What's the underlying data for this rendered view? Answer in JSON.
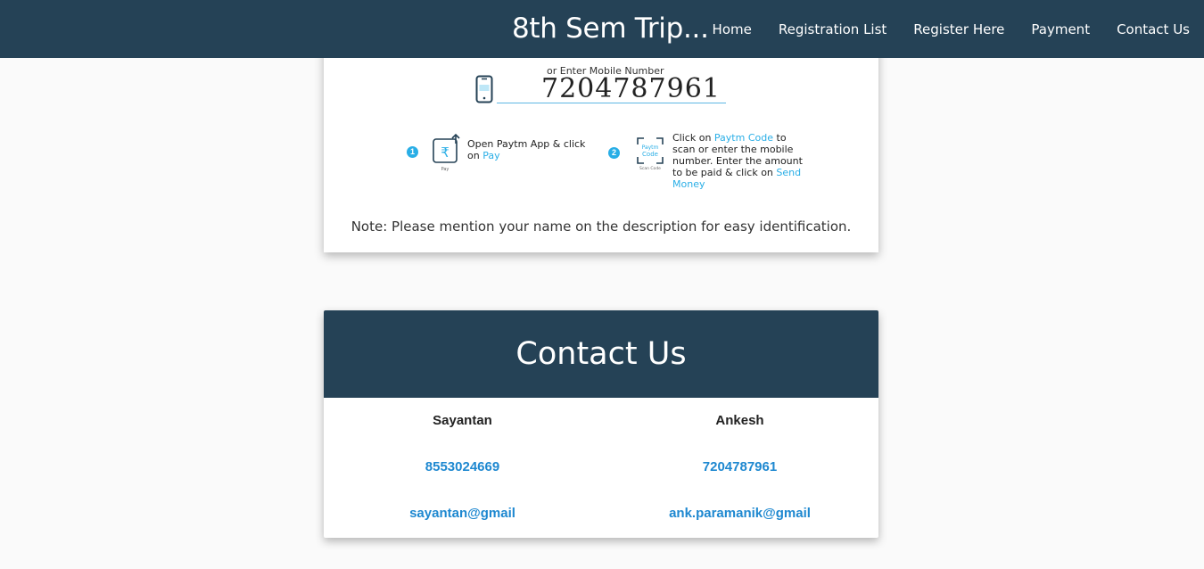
{
  "navbar": {
    "brand": "8th Sem Trip...",
    "links": [
      "Home",
      "Registration List",
      "Register Here",
      "Payment",
      "Contact Us"
    ]
  },
  "payment": {
    "mobile_label": "or Enter Mobile Number",
    "mobile_number": "7204787961",
    "step1": {
      "number": "1",
      "icon_caption": "Pay",
      "text": "Open Paytm App & click on",
      "highlight": "Pay"
    },
    "step2": {
      "number": "2",
      "icon_label": "Paytm Code",
      "icon_caption": "Scan Code",
      "text_prefix": "Click on",
      "highlight1": "Paytm Code",
      "text_middle": "to scan or enter the mobile number. Enter the amount to be paid & click on",
      "highlight2": "Send Money"
    },
    "note": "Note: Please mention your name on the description for easy identification."
  },
  "contact": {
    "title": "Contact Us",
    "people": [
      {
        "name": "Sayantan",
        "phone": "8553024669",
        "email": "sayantan@gmail"
      },
      {
        "name": "Ankesh",
        "phone": "7204787961",
        "email": "ank.paramanik@gmail"
      }
    ]
  },
  "colors": {
    "navbar_bg": "#254256",
    "link_blue": "#1e88d0",
    "paytm_blue": "#29aee6"
  }
}
